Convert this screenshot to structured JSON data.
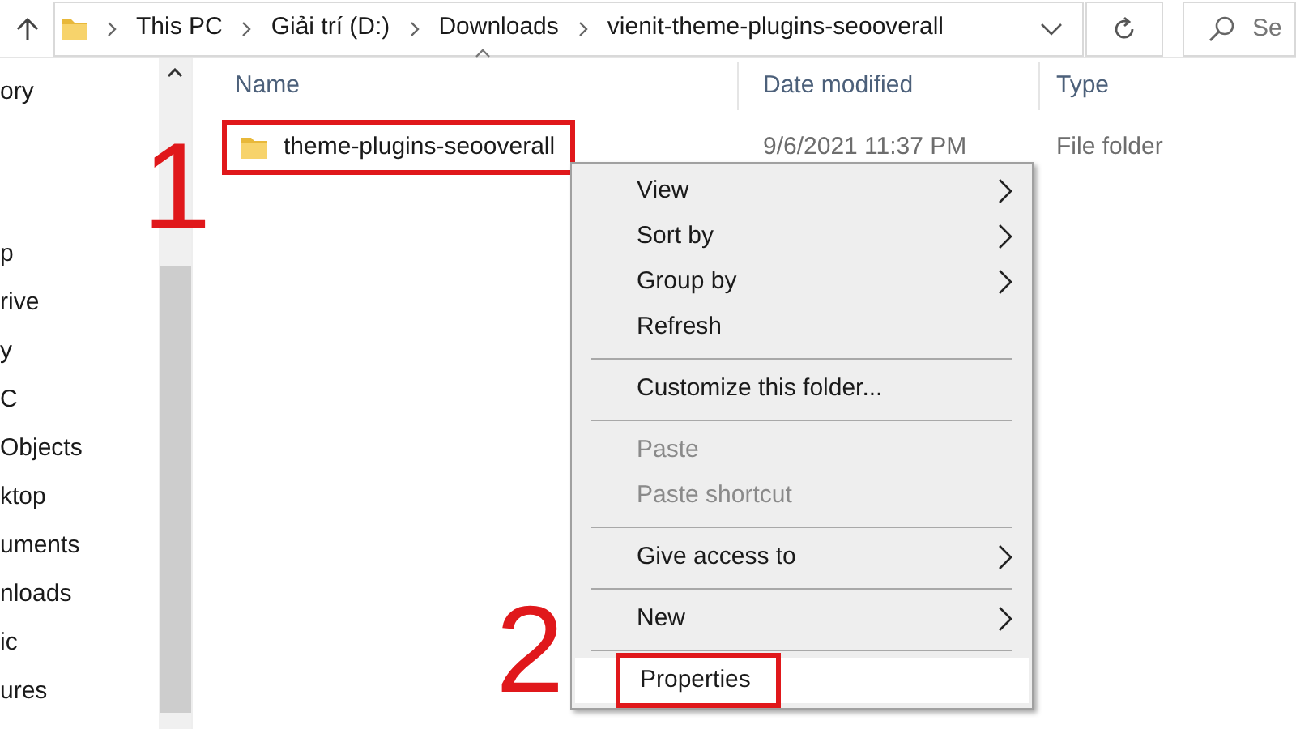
{
  "address_bar": {
    "breadcrumbs": [
      "This PC",
      "Giải trí (D:)",
      "Downloads",
      "vienit-theme-plugins-seooverall"
    ]
  },
  "search": {
    "placeholder": "Se"
  },
  "sidebar": {
    "items": [
      "ory",
      "p",
      "rive",
      "y",
      "C",
      "Objects",
      "ktop",
      "uments",
      "nloads",
      "ic",
      "ures"
    ]
  },
  "table": {
    "columns": [
      {
        "label": "Name",
        "sorted": true
      },
      {
        "label": "Date modified",
        "sorted": false
      },
      {
        "label": "Type",
        "sorted": false
      }
    ],
    "rows": [
      {
        "name": "theme-plugins-seooverall",
        "date": "9/6/2021 11:37 PM",
        "type": "File folder",
        "highlighted": true
      }
    ]
  },
  "context_menu": {
    "items": [
      {
        "kind": "item",
        "label": "View",
        "submenu": true,
        "disabled": false,
        "selected": false
      },
      {
        "kind": "item",
        "label": "Sort by",
        "submenu": true,
        "disabled": false,
        "selected": false
      },
      {
        "kind": "item",
        "label": "Group by",
        "submenu": true,
        "disabled": false,
        "selected": false
      },
      {
        "kind": "item",
        "label": "Refresh",
        "submenu": false,
        "disabled": false,
        "selected": false
      },
      {
        "kind": "separator"
      },
      {
        "kind": "item",
        "label": "Customize this folder...",
        "submenu": false,
        "disabled": false,
        "selected": false
      },
      {
        "kind": "separator"
      },
      {
        "kind": "item",
        "label": "Paste",
        "submenu": false,
        "disabled": true,
        "selected": false
      },
      {
        "kind": "item",
        "label": "Paste shortcut",
        "submenu": false,
        "disabled": true,
        "selected": false
      },
      {
        "kind": "separator"
      },
      {
        "kind": "item",
        "label": "Give access to",
        "submenu": true,
        "disabled": false,
        "selected": false
      },
      {
        "kind": "separator"
      },
      {
        "kind": "item",
        "label": "New",
        "submenu": true,
        "disabled": false,
        "selected": false
      },
      {
        "kind": "separator"
      },
      {
        "kind": "item",
        "label": "Properties",
        "submenu": false,
        "disabled": false,
        "selected": true,
        "highlighted": true
      }
    ]
  },
  "annotations": [
    "1",
    "2"
  ]
}
